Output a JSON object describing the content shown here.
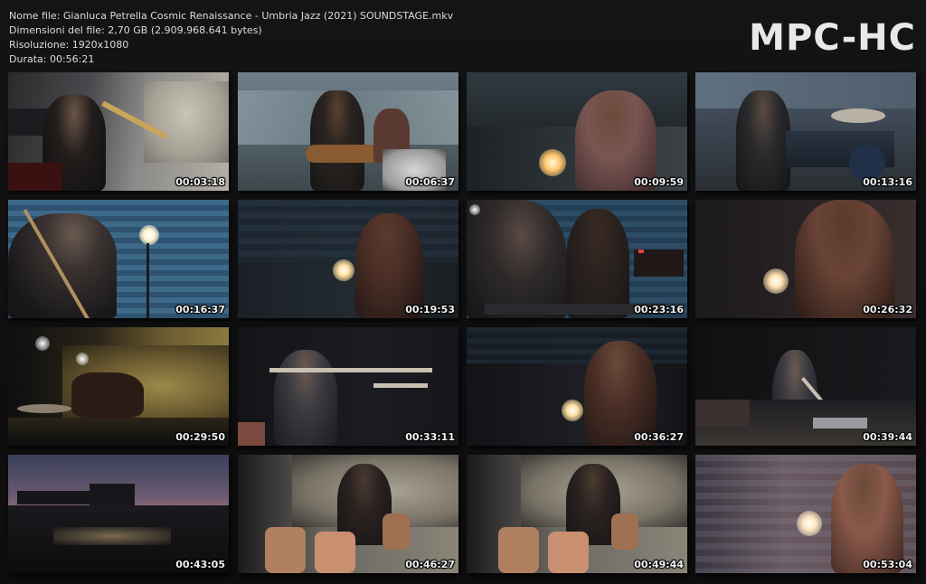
{
  "file_info": {
    "name_line": "Nome file: Gianluca Petrella Cosmic Renaissance - Umbria Jazz (2021) SOUNDSTAGE.mkv",
    "size_line": "Dimensioni del file: 2,70 GB (2.909.968.641 bytes)",
    "resolution_line": "Risoluzione: 1920x1080",
    "duration_line": "Durata: 00:56:21"
  },
  "logo": "MPC-HC",
  "thumbnails": [
    {
      "timestamp": "00:03:18",
      "scene": "trombone-player-outdoor"
    },
    {
      "timestamp": "00:06:37",
      "scene": "bassist-and-drummer"
    },
    {
      "timestamp": "00:09:59",
      "scene": "trumpeter-dark"
    },
    {
      "timestamp": "00:13:16",
      "scene": "drummer-blue"
    },
    {
      "timestamp": "00:16:37",
      "scene": "trombone-backlit"
    },
    {
      "timestamp": "00:19:53",
      "scene": "trumpeter-spotlight"
    },
    {
      "timestamp": "00:23:16",
      "scene": "keyboard-and-vocalist"
    },
    {
      "timestamp": "00:26:32",
      "scene": "trumpeter-spotlight-2"
    },
    {
      "timestamp": "00:29:50",
      "scene": "drums-golden-wall"
    },
    {
      "timestamp": "00:33:11",
      "scene": "trombone-dark"
    },
    {
      "timestamp": "00:36:27",
      "scene": "trumpeter-dark-2"
    },
    {
      "timestamp": "00:39:44",
      "scene": "trombone-synth"
    },
    {
      "timestamp": "00:43:05",
      "scene": "theatre-dusk"
    },
    {
      "timestamp": "00:46:27",
      "scene": "percussionist"
    },
    {
      "timestamp": "00:49:44",
      "scene": "percussionist-2"
    },
    {
      "timestamp": "00:53:04",
      "scene": "trumpeter-pink"
    }
  ],
  "colors": {
    "background": "#111111",
    "text": "#dcdcdc",
    "timestamp": "#f0f0f0"
  }
}
